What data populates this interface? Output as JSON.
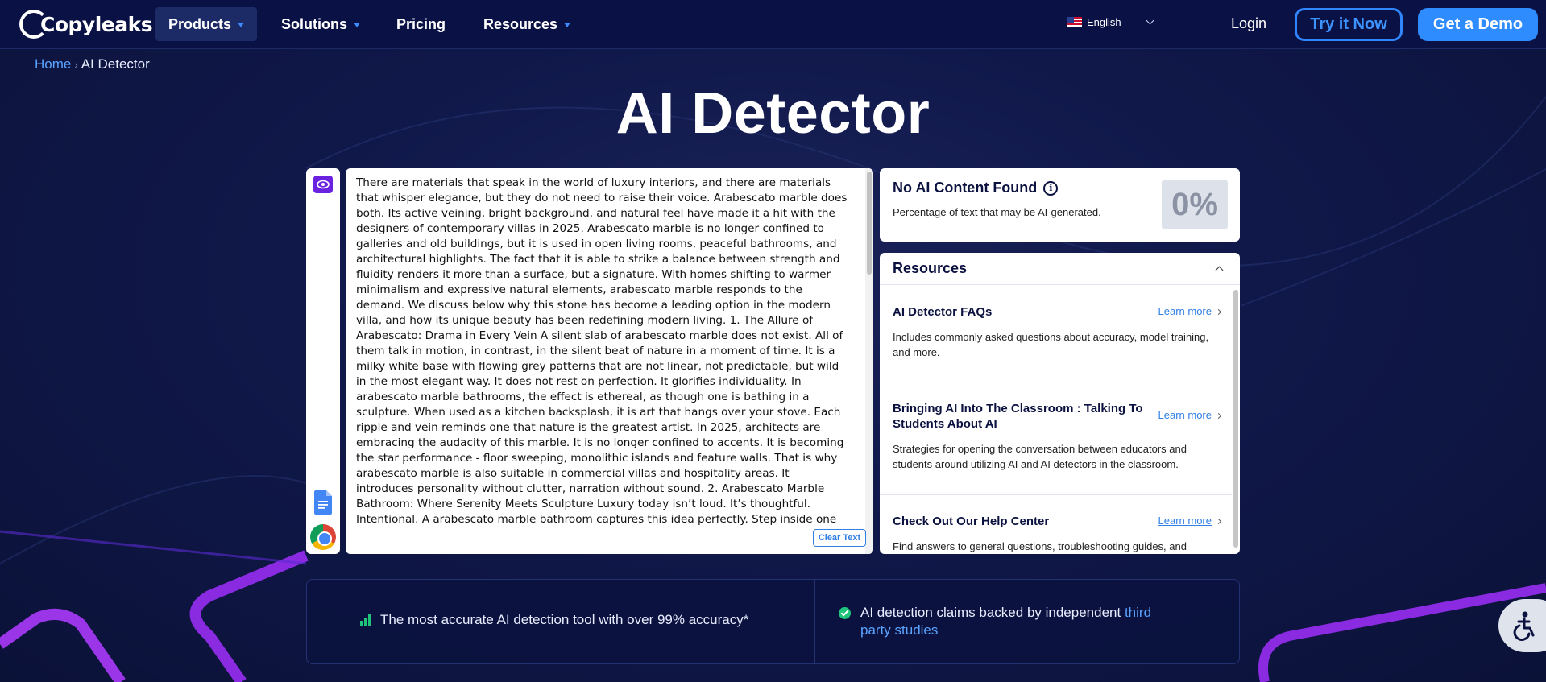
{
  "nav": {
    "logo": "Copyleaks",
    "items": [
      {
        "label": "Products",
        "dropdown": true
      },
      {
        "label": "Solutions",
        "dropdown": true
      },
      {
        "label": "Pricing",
        "dropdown": false
      },
      {
        "label": "Resources",
        "dropdown": true
      }
    ],
    "language": "English",
    "login": "Login",
    "try_now": "Try it Now",
    "get_demo": "Get a Demo"
  },
  "breadcrumb": {
    "home": "Home",
    "separator": "›",
    "current": "AI Detector"
  },
  "page_title": "AI Detector",
  "editor": {
    "text": "There are materials that speak in the world of luxury interiors, and there are materials that whisper elegance, but they do not need to raise their voice. Arabescato marble does both. Its active veining, bright background, and natural feel have made it a hit with the designers of contemporary villas in 2025. Arabescato marble is no longer confined to galleries and old buildings, but it is used in open living rooms, peaceful bathrooms, and architectural highlights. The fact that it is able to strike a balance between strength and fluidity renders it more than a surface, but a signature. With homes shifting to warmer minimalism and expressive natural elements, arabescato marble responds to the demand. We discuss below why this stone has become a leading option in the modern villa, and how its unique beauty has been redefining modern living. 1. The Allure of Arabescato: Drama in Every Vein A silent slab of arabescato marble does not exist. All of them talk in motion, in contrast, in the silent beat of nature in a moment of time. It is a milky white base with flowing grey patterns that are not linear, not predictable, but wild in the most elegant way. It does not rest on perfection. It glorifies individuality. In arabescato marble bathrooms, the effect is ethereal, as though one is bathing in a sculpture. When used as a kitchen backsplash, it is art that hangs over your stove. Each ripple and vein reminds one that nature is the greatest artist. In 2025, architects are embracing the audacity of this marble. It is no longer confined to accents. It is becoming the star performance - floor sweeping, monolithic islands and feature walls. That is why arabescato marble is also suitable in commercial villas and hospitality areas. It introduces personality without clutter, narration without sound. 2. Arabescato Marble Bathroom: Where Serenity Meets Sculpture Luxury today isn’t loud. It’s thoughtful. Intentional. A arabescato marble bathroom captures this idea perfectly. Step inside one and you’ll feel the difference — not just see it. Unlike cold, sterile surfaces, arabescato marble",
    "clear_label": "Clear Text"
  },
  "result": {
    "heading": "No AI Content Found",
    "description": "Percentage of text that may be AI-generated.",
    "percent": "0%"
  },
  "resources": {
    "heading": "Resources",
    "items": [
      {
        "title": "AI Detector FAQs",
        "link": "Learn more",
        "desc": "Includes commonly asked questions about accuracy, model training, and more."
      },
      {
        "title": "Bringing AI Into The Classroom : Talking To Students About AI",
        "link": "Learn more",
        "desc": "Strategies for opening the conversation between educators and students around utilizing AI and AI detectors in the classroom."
      },
      {
        "title": "Check Out Our Help Center",
        "link": "Learn more",
        "desc": "Find answers to general questions, troubleshooting guides, and"
      }
    ]
  },
  "banner": {
    "left": "The most accurate AI detection tool with over 99% accuracy*",
    "right_prefix": "AI detection claims backed by independent",
    "right_link_1": "third",
    "right_link_2": "party studies"
  },
  "colors": {
    "accent": "#2f8cff",
    "nav_bg": "#0a1245",
    "success": "#1fc47a",
    "purple": "#6a22e0"
  }
}
